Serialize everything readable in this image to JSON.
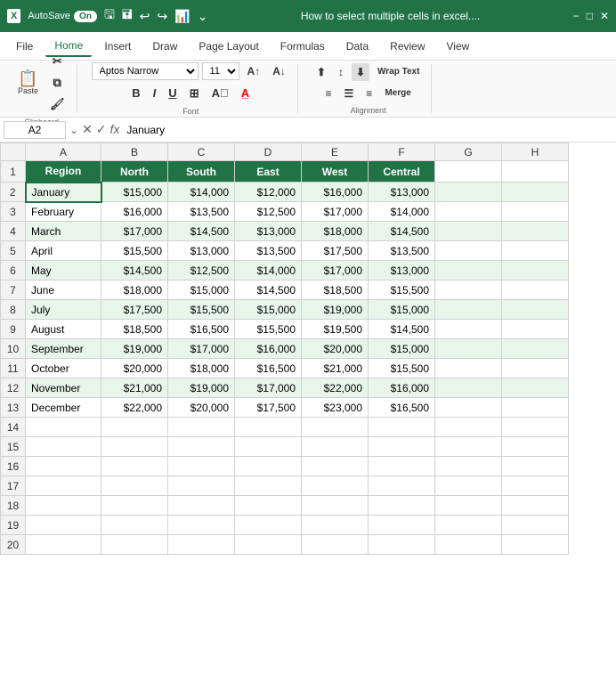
{
  "titleBar": {
    "logo": "X",
    "autosave": "AutoSave",
    "toggle": "On",
    "title": "How to select multiple cells in excel....",
    "icons": [
      "⟲",
      "⟳",
      "⤵",
      "☰"
    ]
  },
  "menuBar": {
    "items": [
      "File",
      "Home",
      "Insert",
      "Draw",
      "Page Layout",
      "Formulas",
      "Data",
      "Review",
      "View"
    ],
    "active": "Home"
  },
  "ribbon": {
    "clipboard": "Clipboard",
    "font": "Aptos Narrow",
    "fontSize": "11",
    "alignment": "Alignment",
    "fontGroup": "Font",
    "wrapText": "Wrap Text",
    "merge": "Merge"
  },
  "formulaBar": {
    "cellRef": "A2",
    "formula": "January"
  },
  "columns": {
    "letters": [
      "",
      "A",
      "B",
      "C",
      "D",
      "E",
      "F",
      "G",
      "H"
    ]
  },
  "headers": {
    "region": "Region",
    "north": "North",
    "south": "South",
    "east": "East",
    "west": "West",
    "central": "Central"
  },
  "rows": [
    {
      "month": "January",
      "north": "$15,000",
      "south": "$14,000",
      "east": "$12,000",
      "west": "$16,000",
      "central": "$13,000",
      "selected": true
    },
    {
      "month": "February",
      "north": "$16,000",
      "south": "$13,500",
      "east": "$12,500",
      "west": "$17,000",
      "central": "$14,000"
    },
    {
      "month": "March",
      "north": "$17,000",
      "south": "$14,500",
      "east": "$13,000",
      "west": "$18,000",
      "central": "$14,500"
    },
    {
      "month": "April",
      "north": "$15,500",
      "south": "$13,000",
      "east": "$13,500",
      "west": "$17,500",
      "central": "$13,500"
    },
    {
      "month": "May",
      "north": "$14,500",
      "south": "$12,500",
      "east": "$14,000",
      "west": "$17,000",
      "central": "$13,000"
    },
    {
      "month": "June",
      "north": "$18,000",
      "south": "$15,000",
      "east": "$14,500",
      "west": "$18,500",
      "central": "$15,500"
    },
    {
      "month": "July",
      "north": "$17,500",
      "south": "$15,500",
      "east": "$15,000",
      "west": "$19,000",
      "central": "$15,000"
    },
    {
      "month": "August",
      "north": "$18,500",
      "south": "$16,500",
      "east": "$15,500",
      "west": "$19,500",
      "central": "$14,500"
    },
    {
      "month": "September",
      "north": "$19,000",
      "south": "$17,000",
      "east": "$16,000",
      "west": "$20,000",
      "central": "$15,000"
    },
    {
      "month": "October",
      "north": "$20,000",
      "south": "$18,000",
      "east": "$16,500",
      "west": "$21,000",
      "central": "$15,500"
    },
    {
      "month": "November",
      "north": "$21,000",
      "south": "$19,000",
      "east": "$17,000",
      "west": "$22,000",
      "central": "$16,000"
    },
    {
      "month": "December",
      "north": "$22,000",
      "south": "$20,000",
      "east": "$17,500",
      "west": "$23,000",
      "central": "$16,500"
    }
  ],
  "emptyRows": [
    14,
    15,
    16,
    17,
    18,
    19,
    20
  ]
}
